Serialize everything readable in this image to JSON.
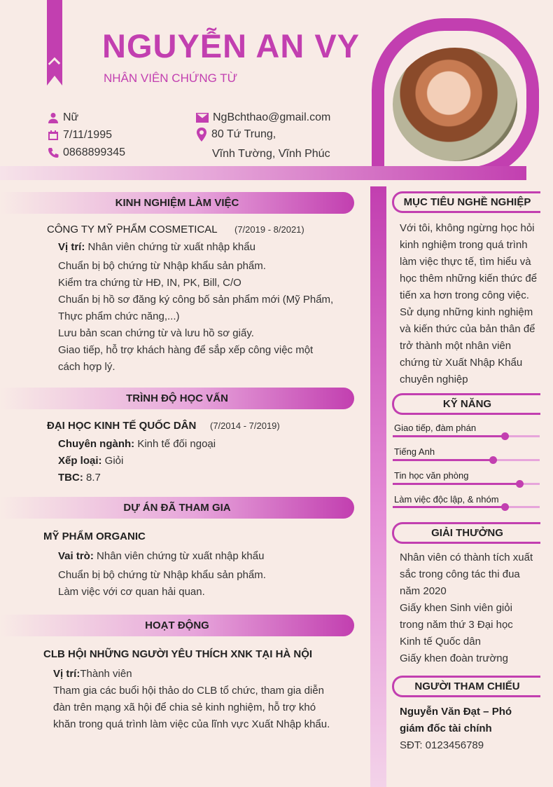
{
  "header": {
    "name": "NGUYỄN AN VY",
    "job_title": "NHÂN VIÊN CHỨNG TỪ"
  },
  "contact": {
    "gender": "Nữ",
    "dob": "7/11/1995",
    "phone": "0868899345",
    "email": "NgBchthao@gmail.com",
    "address_line1": "80 Tứ Trung,",
    "address_line2": "Vĩnh Tường, Vĩnh Phúc"
  },
  "colors": {
    "accent": "#c23fb0",
    "background": "#f8ebe6"
  },
  "experience": {
    "heading": "KINH NGHIỆM LÀM VIỆC",
    "company": "CÔNG TY MỸ PHẨM COSMETICAL",
    "period": "(7/2019 - 8/2021)",
    "position_label": "Vị trí:",
    "position_value": " Nhân viên chứng từ xuất nhập khẩu",
    "lines": [
      "Chuẩn bị bộ chứng từ Nhập khẩu sản phẩm.",
      "Kiểm tra chứng từ HĐ, IN, PK, Bill, C/O",
      "Chuẩn bị hồ sơ đăng ký công bố sản phẩm mới (Mỹ Phẩm,",
      "Thực phẩm chức năng,...)",
      "Lưu bản scan chứng từ và lưu hồ sơ giấy.",
      "Giao tiếp, hỗ trợ khách hàng để sắp xếp công việc một",
      "cách hợp lý."
    ]
  },
  "education": {
    "heading": "TRÌNH ĐỘ HỌC VẤN",
    "school": "ĐẠI HỌC KINH TẾ QUỐC DÂN",
    "period": "(7/2014 - 7/2019)",
    "major_label": "Chuyên ngành:",
    "major_value": " Kinh tế đối ngoại",
    "rank_label": "Xếp loại:",
    "rank_value": " Giỏi",
    "gpa_label": "TBC:",
    "gpa_value": " 8.7"
  },
  "projects": {
    "heading": "DỰ ÁN ĐÃ THAM GIA",
    "name": "MỸ PHẨM ORGANIC",
    "role_label": "Vai trò:",
    "role_value": " Nhân viên chứng từ xuất nhập khẩu",
    "lines": [
      "Chuẩn bị bộ chứng từ Nhập khẩu sản phẩm.",
      "Làm việc với cơ quan hải quan."
    ]
  },
  "activities": {
    "heading": "HOẠT ĐỘNG",
    "club": "CLB HỘI NHỮNG NGƯỜI YÊU THÍCH XNK TẠI HÀ NỘI",
    "position_label": "Vị trí:",
    "position_value": "Thành viên",
    "lines": [
      "Tham gia các buổi hội thảo do CLB tổ chức, tham gia diễn",
      "đàn trên mạng xã hội để chia sẻ kinh nghiệm, hỗ trợ khó",
      "khăn trong quá trình làm việc của lĩnh vực Xuất Nhập khẩu."
    ]
  },
  "objective": {
    "heading": "MỤC TIÊU NGHỀ NGHIỆP",
    "lines": [
      "Với tôi, không ngừng học hỏi",
      "kinh nghiệm trong quá trình",
      "làm việc thực tế, tìm hiểu và",
      "học thêm những kiến thức để",
      "tiến xa hơn trong công việc.",
      "Sử dụng những kinh nghiệm",
      "và kiến thức của bản thân để",
      "trở thành một nhân viên",
      "chứng từ Xuất Nhập Khẩu",
      "chuyên nghiệp"
    ]
  },
  "skills": {
    "heading": "KỸ NĂNG",
    "items": [
      {
        "label": "Giao tiếp, đàm phán",
        "level": 0.76
      },
      {
        "label": "Tiếng Anh",
        "level": 0.68
      },
      {
        "label": "Tin học văn phòng",
        "level": 0.86
      },
      {
        "label": "Làm việc độc lập, & nhóm",
        "level": 0.76
      }
    ]
  },
  "awards": {
    "heading": "GIẢI THƯỞNG",
    "lines": [
      "Nhân viên có thành tích xuất",
      "sắc trong công tác thi đua",
      "năm 2020",
      "Giấy khen Sinh viên giỏi",
      "trong năm thứ 3 Đại học",
      "Kinh tế Quốc dân",
      "Giấy khen đoàn trường"
    ]
  },
  "reference": {
    "heading": "NGƯỜI THAM CHIẾU",
    "name_line1": "Nguyễn Văn Đạt – Phó",
    "name_line2": "giám đốc tài chính",
    "phone": "SĐT: 0123456789"
  },
  "icons": [
    "person-icon",
    "calendar-icon",
    "phone-icon",
    "mail-icon",
    "location-icon",
    "bookmark-ribbon-icon"
  ]
}
